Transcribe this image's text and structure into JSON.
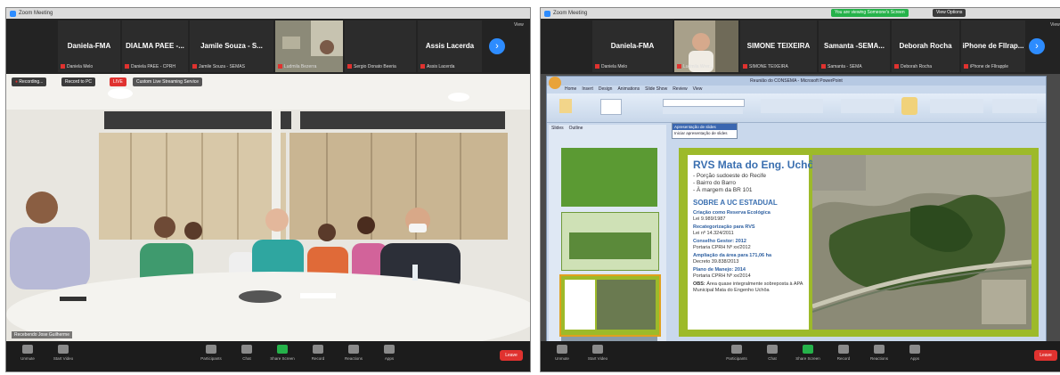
{
  "left": {
    "window_title": "Zoom Meeting",
    "participants": [
      {
        "name": "Daniela-FMA",
        "sub": "Daniela Melo"
      },
      {
        "name": "DIALMA PAEE -...",
        "sub": "Daniela PAEE - CPRH"
      },
      {
        "name": "Jamile Souza - S...",
        "sub": "Jamile Souza - SEMAS"
      },
      {
        "name": "",
        "sub": "Ludmila Bezerra"
      },
      {
        "name": "",
        "sub": "Sergio Donato Beeria"
      },
      {
        "name": "Assis Lacerda",
        "sub": "Assis Lacerda"
      }
    ],
    "view_label": "View",
    "recording_label": "Recording...",
    "record_to_label": "Record to PC",
    "live_label": "LIVE",
    "stream_label": "Custom Live Streaming Service",
    "video_label": "Recebendo Jose Guilherme",
    "toolbar": [
      {
        "label": "Unmute"
      },
      {
        "label": "Start Video"
      },
      {
        "label": "Participants"
      },
      {
        "label": "Chat"
      },
      {
        "label": "Share Screen"
      },
      {
        "label": "Record"
      },
      {
        "label": "Reactions"
      },
      {
        "label": "Apps"
      }
    ],
    "end_label": "Leave"
  },
  "right": {
    "window_title": "Zoom Meeting",
    "share_banner": "You are viewing Someone's Screen",
    "view_options": "View Options",
    "participants": [
      {
        "name": "Daniela-FMA",
        "sub": "Daniela Melo"
      },
      {
        "name": "",
        "sub": "Ludmila Wrer..."
      },
      {
        "name": "SIMONE TEIXEIRA",
        "sub": "SIMONE TEIXEIRA"
      },
      {
        "name": "Samanta -SEMA...",
        "sub": "Samanta - SEMA"
      },
      {
        "name": "Deborah Rocha",
        "sub": "Deborah Rocha"
      },
      {
        "name": "iPhone de Fllrap...",
        "sub": "iPhone de Fllrapple"
      }
    ],
    "view_label": "View",
    "ppt_title": "Reunião do CONSEMA - Microsoft PowerPoint",
    "ppt_tabs": [
      "Home",
      "Insert",
      "Design",
      "Animations",
      "Slide Show",
      "Review",
      "View"
    ],
    "popup_title": "Apresentação de slides",
    "popup_item": "Iniciar apresentação de slides",
    "panel_tabs": [
      "Slides",
      "Outline"
    ],
    "slide": {
      "title": "RVS Mata do Eng. Uchôa",
      "bullets": [
        "- Porção sudoeste do Recife",
        "- Bairro do Barro",
        "- À margem da BR 101"
      ],
      "section": "SOBRE A UC ESTADUAL",
      "blocks": [
        {
          "h": "Criação como Reserva Ecológica",
          "t": "Lei 9.989/1987"
        },
        {
          "h": "Recategorização para RVS",
          "t": "Lei nº 14.324/2011"
        },
        {
          "h": "Conselho Gestor: 2012",
          "t": "Portaria CPRH Nº xx/2012"
        },
        {
          "h": "Ampliação da área para 171,06 ha",
          "t": "Decreto 39.838/2013"
        },
        {
          "h": "Plano de Manejo: 2014",
          "t": "Portaria CPRH Nº xx/2014"
        },
        {
          "h": "OBS:",
          "t": "Área quase integralmente sobreposta à APA Municipal Mata do Engenho Uchôa"
        }
      ]
    },
    "toolbar": [
      {
        "label": "Unmute"
      },
      {
        "label": "Start Video"
      },
      {
        "label": "Participants"
      },
      {
        "label": "Chat"
      },
      {
        "label": "Share Screen"
      },
      {
        "label": "Record"
      },
      {
        "label": "Reactions"
      },
      {
        "label": "Apps"
      }
    ],
    "end_label": "Leave"
  },
  "colors": {
    "zoom_blue": "#2d8cff",
    "red": "#e0322f",
    "green": "#25b24a",
    "slide_green": "#9dba2a"
  }
}
